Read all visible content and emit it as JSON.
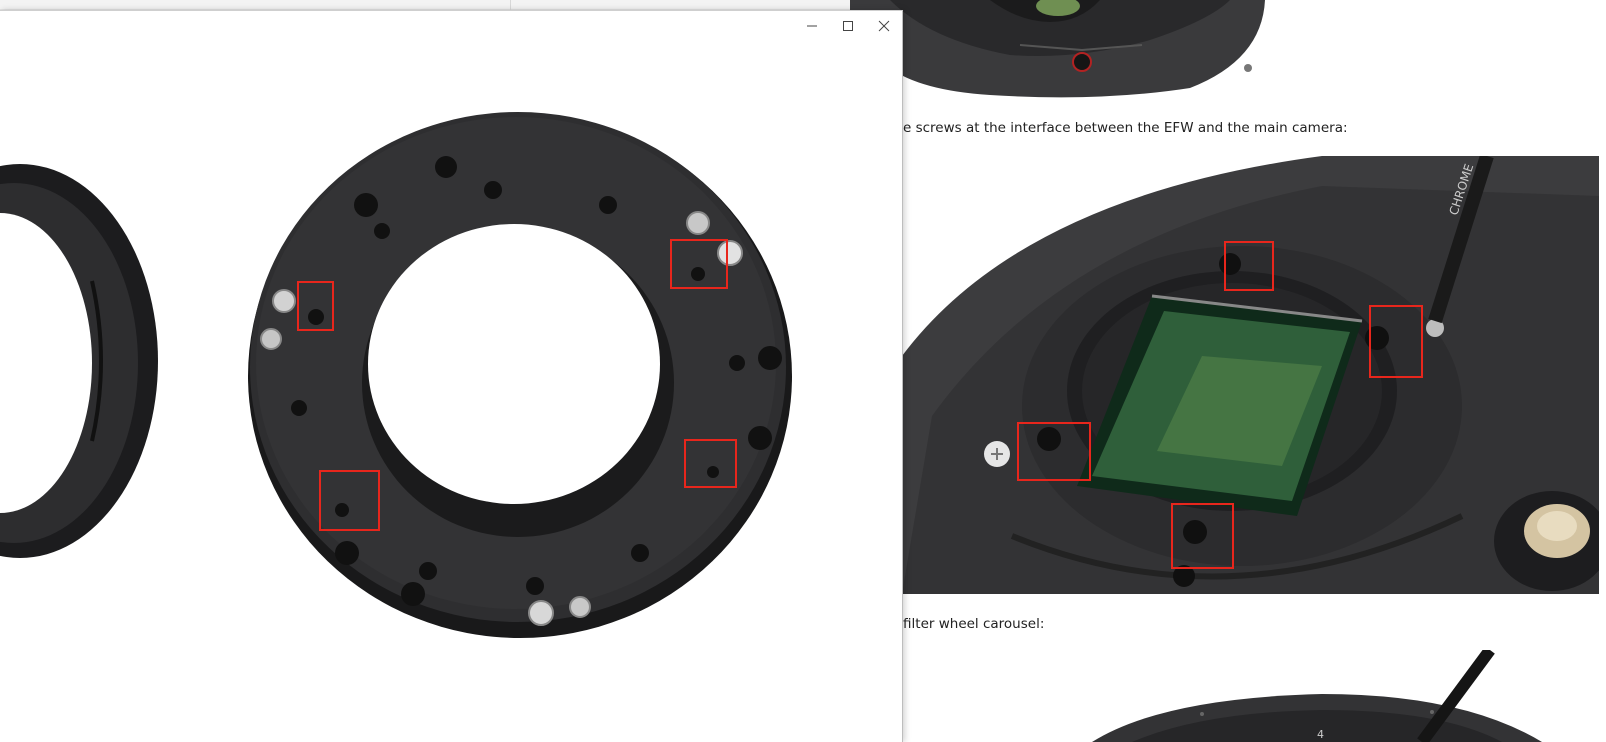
{
  "page": {
    "caption_1": "en the screws at the interface between the EFW and the main camera:",
    "caption_2": ". the filter wheel carousel:"
  },
  "viewer": {
    "controls": {
      "minimize": "minimize-icon",
      "maximize": "maximize-icon",
      "close": "close-icon"
    }
  },
  "colors": {
    "highlight": "#e8261c",
    "metal_dark": "#2e2e30",
    "window_border": "#bdbdbd"
  }
}
